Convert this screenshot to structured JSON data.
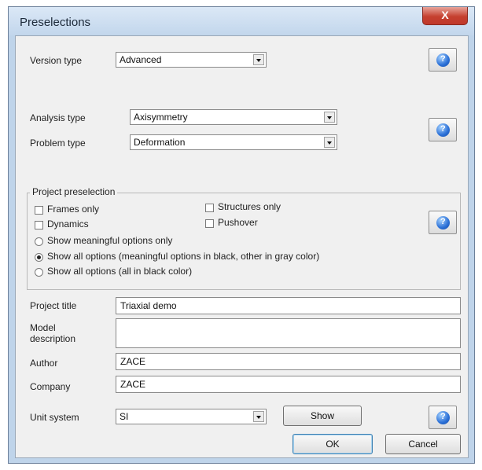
{
  "window": {
    "title": "Preselections",
    "close_label": "X"
  },
  "version": {
    "label": "Version type",
    "value": "Advanced"
  },
  "analysis": {
    "label": "Analysis type",
    "value": "Axisymmetry"
  },
  "problem": {
    "label": "Problem type",
    "value": "Deformation"
  },
  "project_preselection": {
    "legend": "Project preselection",
    "checkboxes": [
      {
        "label": "Frames only",
        "checked": false
      },
      {
        "label": "Structures only",
        "checked": false
      },
      {
        "label": "Dynamics",
        "checked": false
      },
      {
        "label": "Pushover",
        "checked": false
      }
    ],
    "radios": [
      {
        "label": "Show meaningful options only",
        "selected": false
      },
      {
        "label": "Show all options (meaningful options in black, other in gray color)",
        "selected": true
      },
      {
        "label": "Show all options (all in black color)",
        "selected": false
      }
    ]
  },
  "fields": {
    "project_title": {
      "label": "Project title",
      "value": "Triaxial demo"
    },
    "model_description": {
      "label_line1": "Model",
      "label_line2": "description",
      "value": ""
    },
    "author": {
      "label": "Author",
      "value": "ZACE"
    },
    "company": {
      "label": "Company",
      "value": "ZACE"
    }
  },
  "units": {
    "label": "Unit system",
    "value": "SI",
    "show_label": "Show"
  },
  "buttons": {
    "ok": "OK",
    "cancel": "Cancel"
  },
  "icons": {
    "help": "help-question-icon",
    "close": "close-icon"
  }
}
